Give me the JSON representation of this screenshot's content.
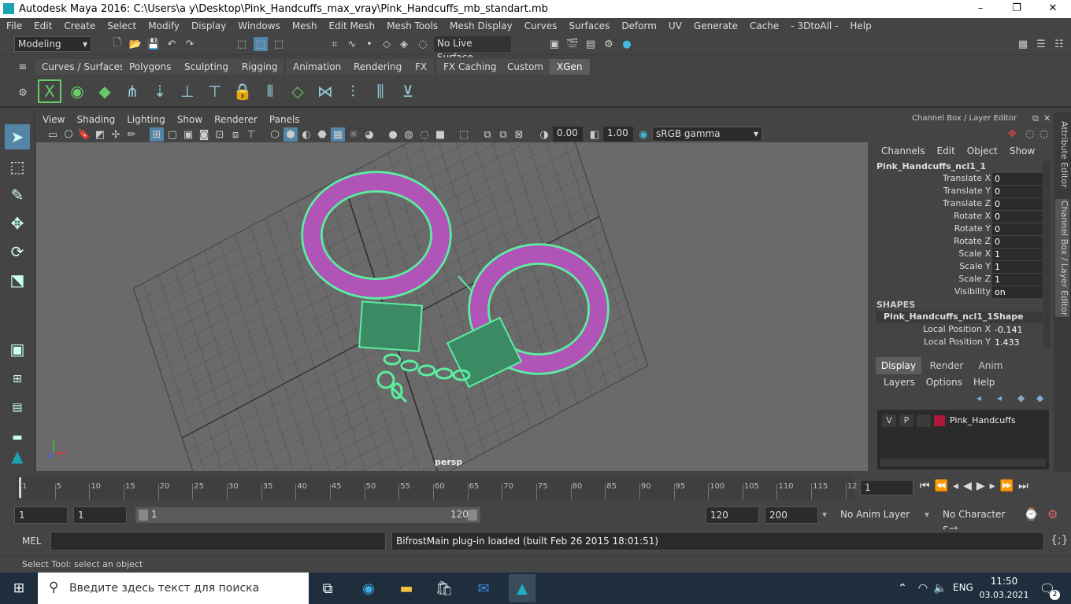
{
  "window": {
    "title": "Autodesk Maya 2016: C:\\Users\\a y\\Desktop\\Pink_Handcuffs_max_vray\\Pink_Handcuffs_mb_standart.mb",
    "minimize": "–",
    "maximize": "❐",
    "close": "✕"
  },
  "menu": [
    "File",
    "Edit",
    "Create",
    "Select",
    "Modify",
    "Display",
    "Windows",
    "Mesh",
    "Edit Mesh",
    "Mesh Tools",
    "Mesh Display",
    "Curves",
    "Surfaces",
    "Deform",
    "UV",
    "Generate",
    "Cache",
    "- 3DtoAll -",
    "Help"
  ],
  "status": {
    "mode": "Modeling",
    "live_surface": "No Live Surface"
  },
  "shelf_tabs": [
    "Curves / Surfaces",
    "Polygons",
    "Sculpting",
    "Rigging",
    "Animation",
    "Rendering",
    "FX",
    "FX Caching",
    "Custom",
    "XGen"
  ],
  "shelf_active": "XGen",
  "viewport_menu": [
    "View",
    "Shading",
    "Lighting",
    "Show",
    "Renderer",
    "Panels"
  ],
  "viewport_toolbar": {
    "exposure": "0.00",
    "gamma": "1.00",
    "colorspace": "sRGB gamma"
  },
  "viewport_label": "persp",
  "channel_box": {
    "title": "Channel Box / Layer Editor",
    "menus": [
      "Channels",
      "Edit",
      "Object",
      "Show"
    ],
    "object": "Pink_Handcuffs_ncl1_1",
    "channels": [
      {
        "label": "Translate X",
        "value": "0"
      },
      {
        "label": "Translate Y",
        "value": "0"
      },
      {
        "label": "Translate Z",
        "value": "0"
      },
      {
        "label": "Rotate X",
        "value": "0"
      },
      {
        "label": "Rotate Y",
        "value": "0"
      },
      {
        "label": "Rotate Z",
        "value": "0"
      },
      {
        "label": "Scale X",
        "value": "1"
      },
      {
        "label": "Scale Y",
        "value": "1"
      },
      {
        "label": "Scale Z",
        "value": "1"
      },
      {
        "label": "Visibility",
        "value": "on"
      }
    ],
    "shapes_heading": "SHAPES",
    "shape_name": "Pink_Handcuffs_ncl1_1Shape",
    "shape_channels": [
      {
        "label": "Local Position X",
        "value": "-0.141"
      },
      {
        "label": "Local Position Y",
        "value": "1.433"
      }
    ]
  },
  "layer_editor": {
    "tabs": [
      "Display",
      "Render",
      "Anim"
    ],
    "active_tab": "Display",
    "menus": [
      "Layers",
      "Options",
      "Help"
    ],
    "layer": {
      "v": "V",
      "p": "P",
      "name": "Pink_Handcuffs",
      "color": "#b0183a"
    }
  },
  "side_tabs": [
    "Attribute Editor",
    "Channel Box / Layer Editor"
  ],
  "timeline": {
    "ticks": [
      "1",
      "5",
      "10",
      "15",
      "20",
      "25",
      "30",
      "35",
      "40",
      "45",
      "50",
      "55",
      "60",
      "65",
      "70",
      "75",
      "80",
      "85",
      "90",
      "95",
      "100",
      "105",
      "110",
      "115",
      "12"
    ],
    "current": "1"
  },
  "range": {
    "start": "1",
    "start2": "1",
    "slider_start": "1",
    "slider_end": "120",
    "end": "120",
    "end2": "200",
    "anim_layer": "No Anim Layer",
    "char_set": "No Character Set"
  },
  "mel": {
    "label": "MEL",
    "output": "BifrostMain plug-in loaded (built Feb 26 2015 18:01:51)"
  },
  "help_line": "Select Tool: select an object",
  "taskbar": {
    "search_placeholder": "Введите здесь текст для поиска",
    "lang": "ENG",
    "time": "11:50",
    "date": "03.03.2021",
    "notifications": "2"
  }
}
